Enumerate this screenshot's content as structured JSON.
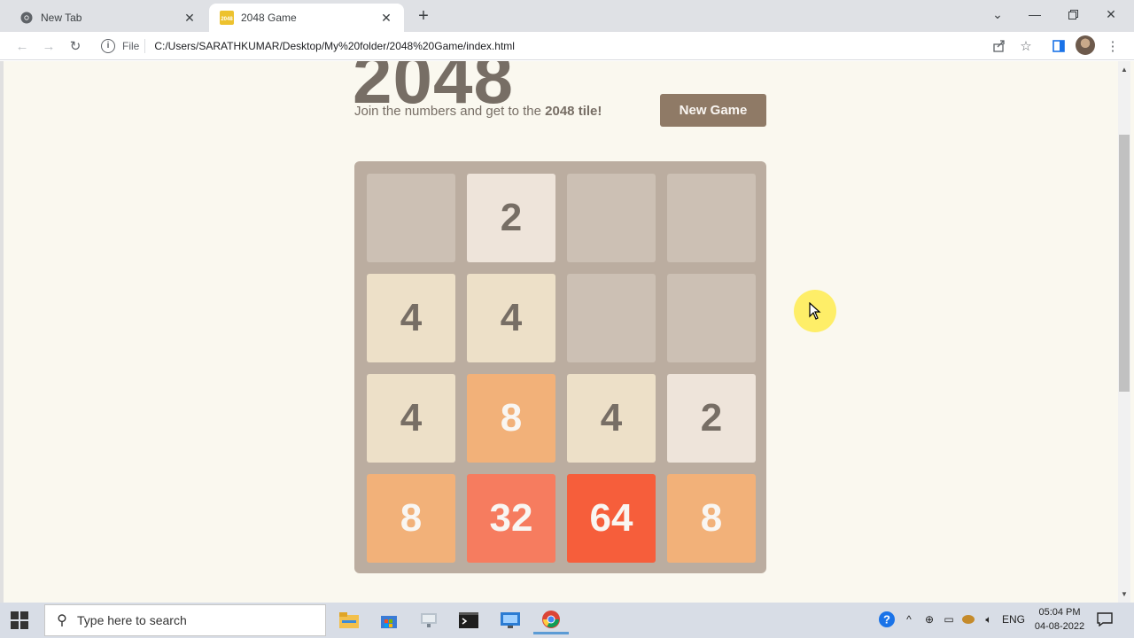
{
  "browser": {
    "tabs": [
      {
        "title": "New Tab",
        "icon": "chrome-icon",
        "active": false
      },
      {
        "title": "2048 Game",
        "icon": "game-favicon",
        "active": true
      }
    ],
    "favicon_text": "2048",
    "url_scheme": "File",
    "url": "C:/Users/SARATHKUMAR/Desktop/My%20folder/2048%20Game/index.html"
  },
  "game": {
    "title": "2048",
    "intro_text": "Join the numbers and get to the ",
    "intro_bold": "2048 tile!",
    "new_game_label": "New Game",
    "grid": [
      [
        "",
        "2",
        "",
        ""
      ],
      [
        "4",
        "4",
        "",
        ""
      ],
      [
        "4",
        "8",
        "4",
        "2"
      ],
      [
        "8",
        "32",
        "64",
        "8"
      ]
    ],
    "tile_colors": {
      "2": {
        "bg": "#eee4da",
        "fg": "#776e65"
      },
      "4": {
        "bg": "#ede0c8",
        "fg": "#776e65"
      },
      "8": {
        "bg": "#f2b179",
        "fg": "#f9f6f2"
      },
      "32": {
        "bg": "#f67c5f",
        "fg": "#f9f6f2"
      },
      "64": {
        "bg": "#f65e3b",
        "fg": "#f9f6f2"
      }
    }
  },
  "taskbar": {
    "search_placeholder": "Type here to search",
    "language": "ENG",
    "time": "05:04 PM",
    "date": "04-08-2022",
    "apps": [
      "file-explorer-icon",
      "store-icon",
      "network-folder-icon",
      "terminal-icon",
      "remote-desktop-icon",
      "chrome-icon"
    ]
  }
}
